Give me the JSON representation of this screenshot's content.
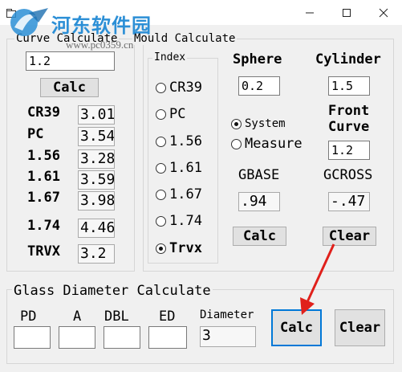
{
  "window": {
    "title": ""
  },
  "watermark": {
    "title": "河东软件园",
    "url": "www.pc0359.cn"
  },
  "curve": {
    "title": "Curve Calculate",
    "input_value": "1.2",
    "calc_label": "Calc",
    "rows": [
      {
        "label": "CR39",
        "value": "3.01"
      },
      {
        "label": "PC",
        "value": "3.54"
      },
      {
        "label": "1.56",
        "value": "3.28"
      },
      {
        "label": "1.61",
        "value": "3.59"
      },
      {
        "label": "1.67",
        "value": "3.98"
      },
      {
        "label": "1.74",
        "value": "4.46"
      },
      {
        "label": "TRVX",
        "value": "3.2"
      }
    ]
  },
  "mould": {
    "title": "Mould Calculate",
    "index_title": "Index",
    "index_options": [
      "CR39",
      "PC",
      "1.56",
      "1.61",
      "1.67",
      "1.74",
      "Trvx"
    ],
    "selected_index": "Trvx",
    "sphere_label": "Sphere",
    "sphere_value": "0.2",
    "cylinder_label": "Cylinder",
    "cylinder_value": "1.5",
    "mode_options": [
      "System",
      "Measure"
    ],
    "selected_mode": "System",
    "front_curve_label_line1": "Front",
    "front_curve_label_line2": "Curve",
    "front_curve_value": "1.2",
    "gbase_label": "GBASE",
    "gbase_value": ".94",
    "gcross_label": "GCROSS",
    "gcross_value": "-.47",
    "calc_label": "Calc",
    "clear_label": "Clear"
  },
  "glass": {
    "title": "Glass Diameter Calculate",
    "pd_label": "PD",
    "a_label": "A",
    "dbl_label": "DBL",
    "ed_label": "ED",
    "diameter_label": "Diameter",
    "pd_value": "",
    "a_value": "",
    "dbl_value": "",
    "ed_value": "",
    "diameter_value": "3",
    "calc_label": "Calc",
    "clear_label": "Clear"
  },
  "annotation": {
    "arrow_color": "#e0201b"
  },
  "colors": {
    "focus": "#0078d7",
    "watermark": "#2c8fd6"
  }
}
